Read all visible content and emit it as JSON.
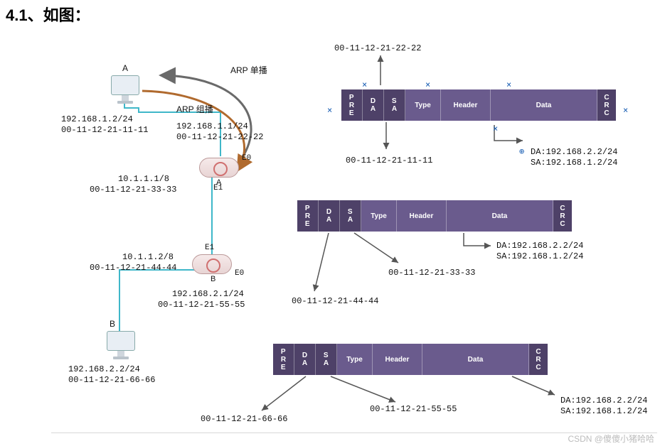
{
  "section_title": "4.1、如图：",
  "watermark": "CSDN @傻傻小猪哈哈",
  "nodes": {
    "A": {
      "label": "A",
      "ip": "192.168.1.2/24",
      "mac": "00-11-12-21-11-11"
    },
    "B": {
      "label": "B",
      "ip": "192.168.2.2/24",
      "mac": "00-11-12-21-66-66"
    },
    "routerA": {
      "label": "A",
      "E0": {
        "port": "E0",
        "ip": "192.168.1.1/24",
        "mac": "00-11-12-21-22-22"
      },
      "E1": {
        "port": "E1",
        "ip": "10.1.1.1/8",
        "mac": "00-11-12-21-33-33"
      }
    },
    "routerB": {
      "label": "B",
      "E1": {
        "port": "E1",
        "ip": "10.1.1.2/8",
        "mac": "00-11-12-21-44-44"
      },
      "E0": {
        "port": "E0",
        "ip": "192.168.2.1/24",
        "mac": "00-11-12-21-55-55"
      }
    }
  },
  "arp": {
    "unicast": "ARP 单播",
    "multicast": "ARP 组播"
  },
  "packet_labels": {
    "pre": "PRE",
    "da": "DA",
    "sa": "SA",
    "type": "Type",
    "hdr": "Header",
    "data": "Data",
    "crc": "CRC"
  },
  "packets": [
    {
      "da": "00-11-12-21-22-22",
      "sa": "00-11-12-21-11-11",
      "ip_da": "DA:192.168.2.2/24",
      "ip_sa": "SA:192.168.1.2/24"
    },
    {
      "da": "00-11-12-21-44-44",
      "sa": "00-11-12-21-33-33",
      "ip_da": "DA:192.168.2.2/24",
      "ip_sa": "SA:192.168.1.2/24"
    },
    {
      "da": "00-11-12-21-66-66",
      "sa": "00-11-12-21-55-55",
      "ip_da": "DA:192.168.2.2/24",
      "ip_sa": "SA:192.168.1.2/24"
    }
  ]
}
